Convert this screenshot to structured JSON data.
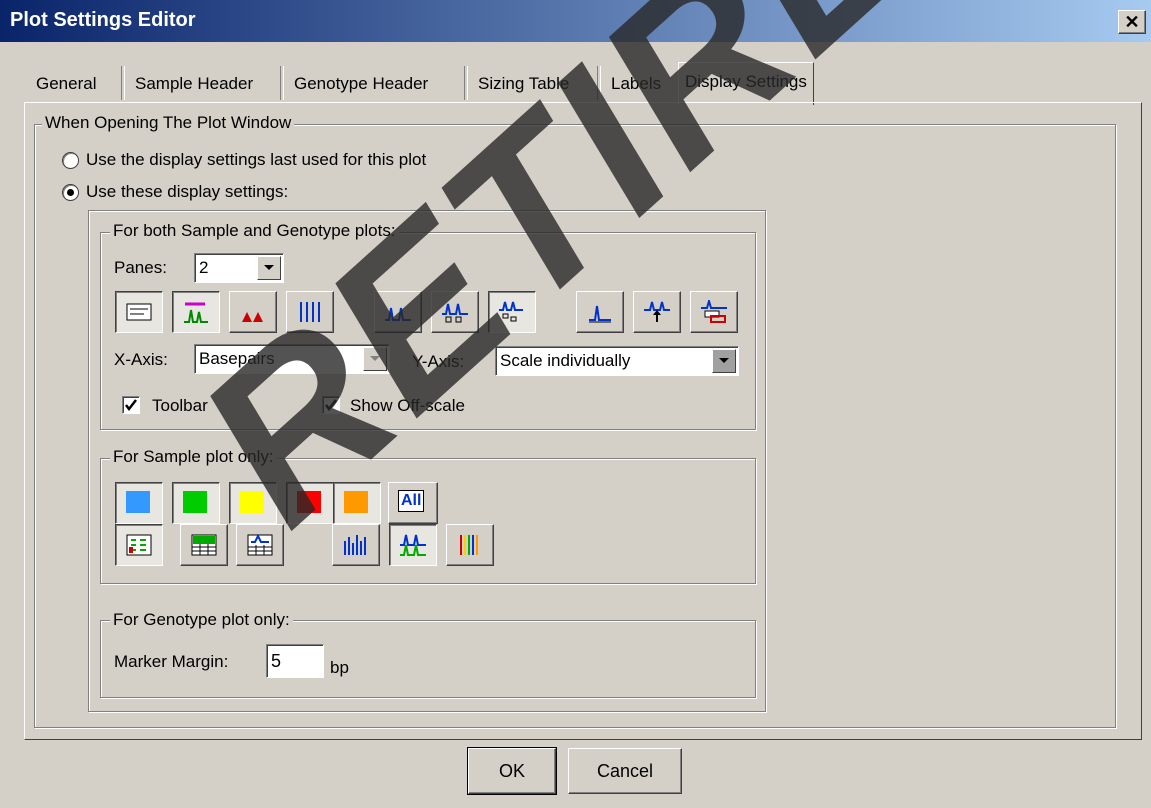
{
  "window": {
    "title": "Plot Settings Editor",
    "close_glyph": "✕"
  },
  "tabs": [
    {
      "label": "General"
    },
    {
      "label": "Sample Header"
    },
    {
      "label": "Genotype Header"
    },
    {
      "label": "Sizing Table"
    },
    {
      "label": "Labels"
    },
    {
      "label": "Display Settings",
      "active": true
    }
  ],
  "open_group": {
    "legend": "When Opening The Plot Window",
    "radio_last": {
      "label": "Use the display settings last used for this plot",
      "selected": false
    },
    "radio_these": {
      "label": "Use these display settings:",
      "selected": true
    }
  },
  "both_group": {
    "legend": "For both Sample and Genotype plots:",
    "panes_label": "Panes:",
    "panes_value": "2",
    "xaxis_label": "X-Axis:",
    "xaxis_value": "Basepairs",
    "yaxis_label": "Y-Axis:",
    "yaxis_value": "Scale individually",
    "toolbar_label": "Toolbar",
    "toolbar_checked": true,
    "offscale_label": "Show Off-scale",
    "offscale_checked": true,
    "toolbar_icons": [
      "header-table-icon",
      "dye-peaks-icon",
      "filled-peaks-icon",
      "overlay-lines-icon",
      "peaks-single-icon",
      "peaks-labeled-icon",
      "peaks-multi-icon",
      "axis-peak-icon",
      "arrow-peak-icon",
      "peak-table-icon"
    ]
  },
  "sample_group": {
    "legend": "For Sample plot only:",
    "dye_colors": [
      "#3399ff",
      "#00cc00",
      "#ffff00",
      "#ff0000",
      "#ff9900"
    ],
    "all_label": "All"
  },
  "genotype_group": {
    "legend": "For Genotype plot only:",
    "margin_label": "Marker Margin:",
    "margin_value": "5",
    "margin_unit": "bp"
  },
  "buttons": {
    "ok": "OK",
    "cancel": "Cancel"
  },
  "watermark": "RETIRED"
}
